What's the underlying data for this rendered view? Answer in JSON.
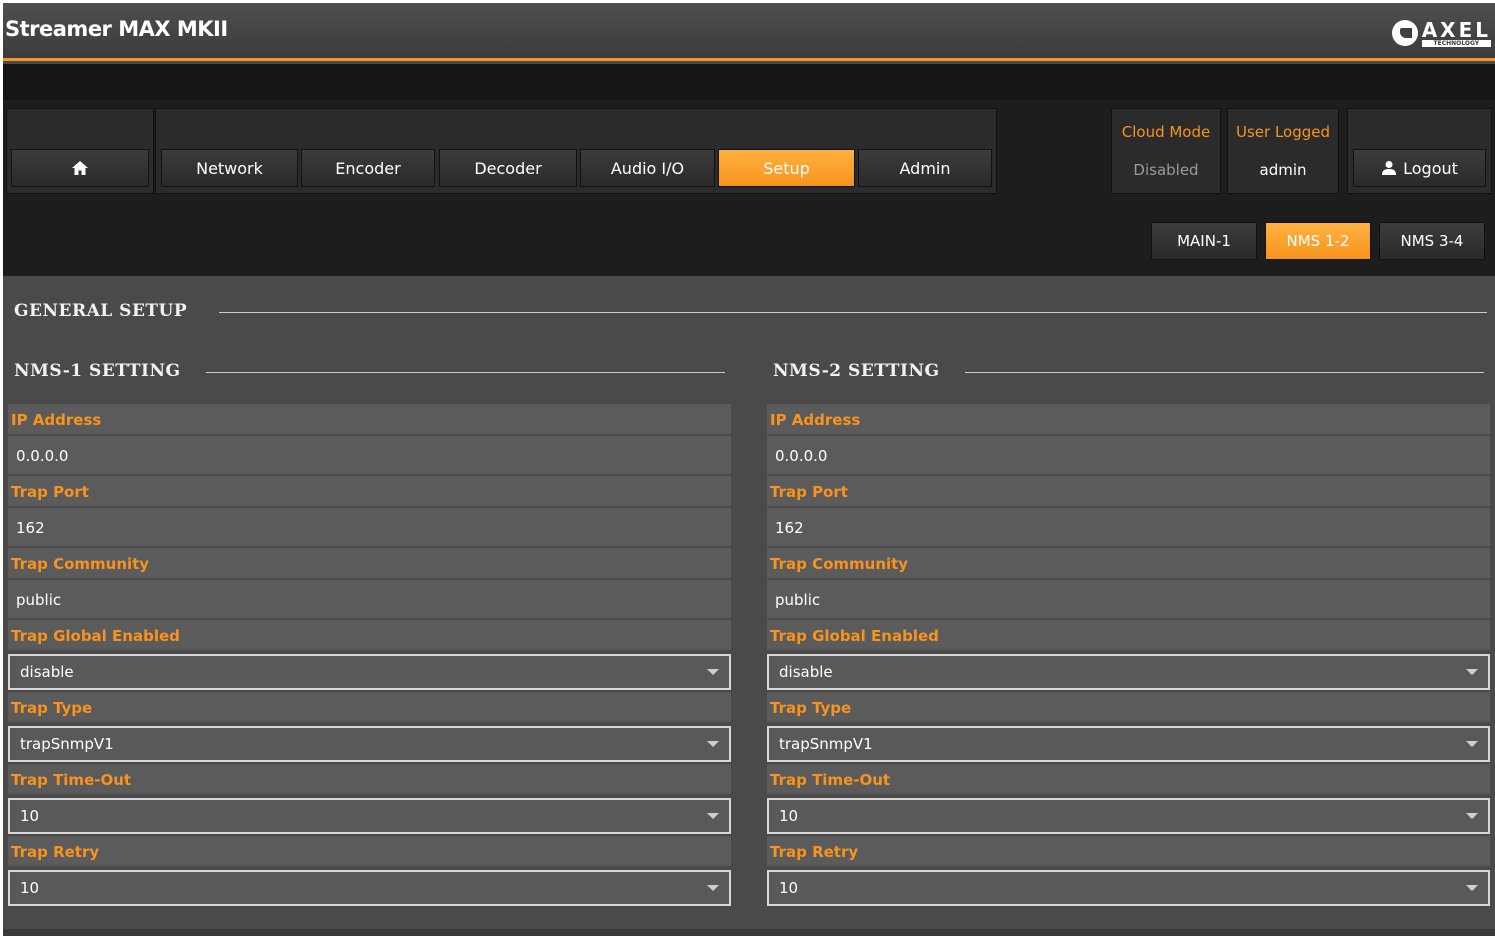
{
  "app": {
    "title": "Streamer MAX MKII",
    "logo_text": "AXEL",
    "logo_sub": "TECHNOLOGY"
  },
  "nav": {
    "home_icon": "home-icon",
    "items": [
      {
        "label": "Network"
      },
      {
        "label": "Encoder"
      },
      {
        "label": "Decoder"
      },
      {
        "label": "Audio I/O"
      },
      {
        "label": "Setup",
        "active": true
      },
      {
        "label": "Admin"
      }
    ]
  },
  "status": {
    "cloud_mode_label": "Cloud Mode",
    "cloud_mode_value": "Disabled",
    "user_logged_label": "User Logged",
    "user_logged_value": "admin",
    "logout_label": "Logout",
    "logout_icon": "user-icon"
  },
  "subtabs": [
    {
      "label": "MAIN-1"
    },
    {
      "label": "NMS 1-2",
      "active": true
    },
    {
      "label": "NMS 3-4"
    }
  ],
  "general_title": "GENERAL SETUP",
  "nms1": {
    "title": "NMS-1 SETTING",
    "ip_label": "IP Address",
    "ip_value": "0.0.0.0",
    "port_label": "Trap Port",
    "port_value": "162",
    "community_label": "Trap Community",
    "community_value": "public",
    "global_label": "Trap Global Enabled",
    "global_value": "disable",
    "type_label": "Trap Type",
    "type_value": "trapSnmpV1",
    "timeout_label": "Trap Time-Out",
    "timeout_value": "10",
    "retry_label": "Trap Retry",
    "retry_value": "10"
  },
  "nms2": {
    "title": "NMS-2 SETTING",
    "ip_label": "IP Address",
    "ip_value": "0.0.0.0",
    "port_label": "Trap Port",
    "port_value": "162",
    "community_label": "Trap Community",
    "community_value": "public",
    "global_label": "Trap Global Enabled",
    "global_value": "disable",
    "type_label": "Trap Type",
    "type_value": "trapSnmpV1",
    "timeout_label": "Trap Time-Out",
    "timeout_value": "10",
    "retry_label": "Trap Retry",
    "retry_value": "10"
  },
  "colors": {
    "accent": "#f7931e",
    "panel": "#4a4a4a",
    "dark": "#1d1d1d"
  }
}
